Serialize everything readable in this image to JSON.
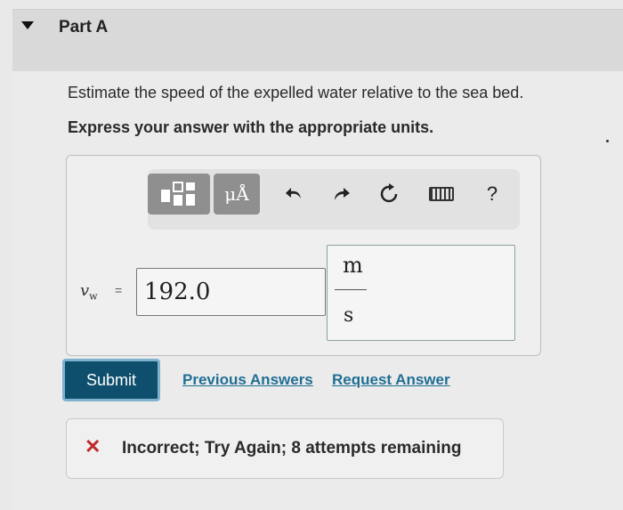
{
  "part": {
    "title": "Part A"
  },
  "question": {
    "text": "Estimate the speed of the expelled water relative to the sea bed.",
    "instruction": "Express your answer with the appropriate units."
  },
  "toolbar": {
    "units_label": "μÅ",
    "help_label": "?"
  },
  "answer": {
    "variable": "v",
    "variable_sub": "w",
    "equals": "=",
    "value": "192.0",
    "unit_numerator": "m",
    "unit_denominator": "s"
  },
  "actions": {
    "submit_label": "Submit",
    "previous_answers_label": "Previous Answers",
    "request_answer_label": "Request Answer"
  },
  "feedback": {
    "icon": "x-icon",
    "text": "Incorrect; Try Again; 8 attempts remaining",
    "status_color": "#c0282a"
  }
}
